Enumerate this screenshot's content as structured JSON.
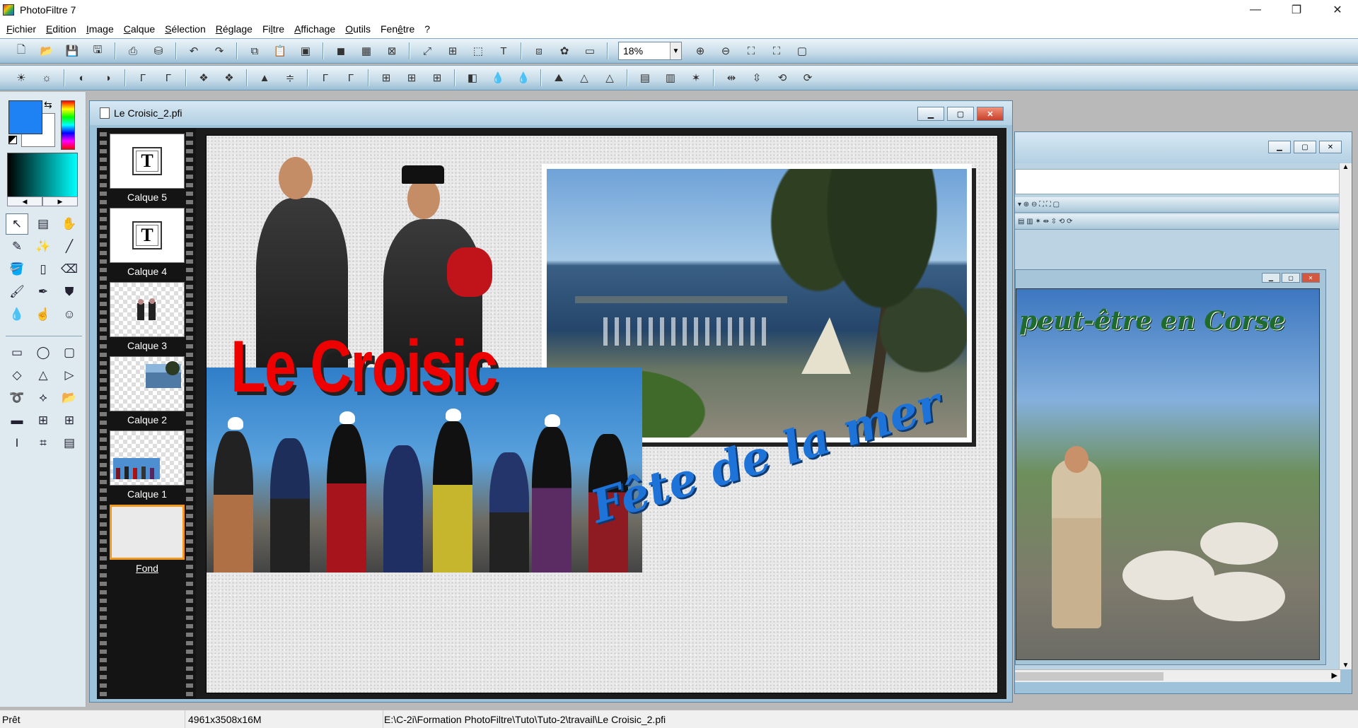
{
  "app": {
    "title": "PhotoFiltre 7",
    "window_controls": [
      "—",
      "❐",
      "✕"
    ]
  },
  "menu": [
    {
      "pre": "",
      "ul": "F",
      "post": "ichier"
    },
    {
      "pre": "",
      "ul": "E",
      "post": "dition"
    },
    {
      "pre": "",
      "ul": "I",
      "post": "mage"
    },
    {
      "pre": "",
      "ul": "C",
      "post": "alque"
    },
    {
      "pre": "",
      "ul": "S",
      "post": "élection"
    },
    {
      "pre": "",
      "ul": "R",
      "post": "églage"
    },
    {
      "pre": "Fi",
      "ul": "l",
      "post": "tre"
    },
    {
      "pre": "",
      "ul": "A",
      "post": "ffichage"
    },
    {
      "pre": "",
      "ul": "O",
      "post": "utils"
    },
    {
      "pre": "Fen",
      "ul": "ê",
      "post": "tre"
    },
    {
      "pre": "",
      "ul": "",
      "post": "?"
    }
  ],
  "toolbar": {
    "zoom_value": "18%"
  },
  "colors": {
    "foreground": "#1e82f5",
    "background": "#ffffff"
  },
  "document": {
    "title": "Le Croisic_2.pfi",
    "layers": [
      {
        "label": "Calque 5",
        "kind": "text"
      },
      {
        "label": "Calque 4",
        "kind": "text"
      },
      {
        "label": "Calque 3",
        "kind": "image"
      },
      {
        "label": "Calque 2",
        "kind": "image"
      },
      {
        "label": "Calque 1",
        "kind": "image"
      },
      {
        "label": "Fond",
        "kind": "background",
        "selected": true
      }
    ],
    "canvas_title": "Le Croisic",
    "canvas_subtitle": "Fête de la mer"
  },
  "second_document": {
    "canvas_text": "peut-être en Corse"
  },
  "statusbar": {
    "state": "Prêt",
    "dimensions": "4961x3508x16M",
    "path": "E:\\C-2i\\Formation PhotoFiltre\\Tuto\\Tuto-2\\travail\\Le Croisic_2.pfi"
  }
}
